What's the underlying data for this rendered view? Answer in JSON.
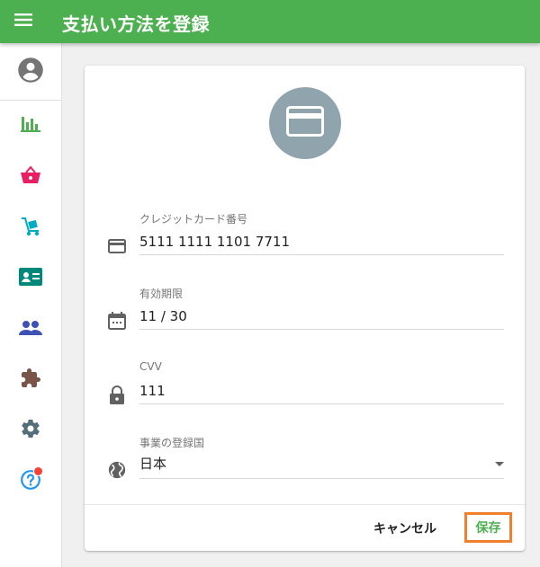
{
  "app": {
    "title": "支払い方法を登録"
  },
  "sidebar": {
    "items": [
      {
        "icon": "account-circle-icon",
        "color": "#757575"
      },
      {
        "icon": "bar-chart-icon",
        "color": "#4caf50"
      },
      {
        "icon": "basket-icon",
        "color": "#e91e63"
      },
      {
        "icon": "hand-truck-icon",
        "color": "#00acc1"
      },
      {
        "icon": "contact-card-icon",
        "color": "#00897b"
      },
      {
        "icon": "people-icon",
        "color": "#3f51b5"
      },
      {
        "icon": "puzzle-icon",
        "color": "#795548"
      },
      {
        "icon": "gear-icon",
        "color": "#546e7a"
      },
      {
        "icon": "help-icon",
        "color": "#2196f3",
        "badge": true,
        "badge_color": "#f44336"
      }
    ]
  },
  "form": {
    "avatar_icon": "credit-card-icon",
    "avatar_color": "#90a4ae",
    "card_number": {
      "label": "クレジットカード番号",
      "value": "5111 1111 1101 7711",
      "icon": "credit-card-icon"
    },
    "expiry": {
      "label": "有効期限",
      "value": "11 / 30",
      "icon": "calendar-icon"
    },
    "cvv": {
      "label": "CVV",
      "value": "111",
      "icon": "lock-icon"
    },
    "country": {
      "label": "事業の登録国",
      "value": "日本",
      "icon": "globe-icon"
    }
  },
  "actions": {
    "cancel_label": "キャンセル",
    "save_label": "保存",
    "save_color": "#4caf50",
    "highlight_color": "#f0802c"
  },
  "colors": {
    "app_bar": "#4caf50",
    "background": "#f0f0f0"
  }
}
